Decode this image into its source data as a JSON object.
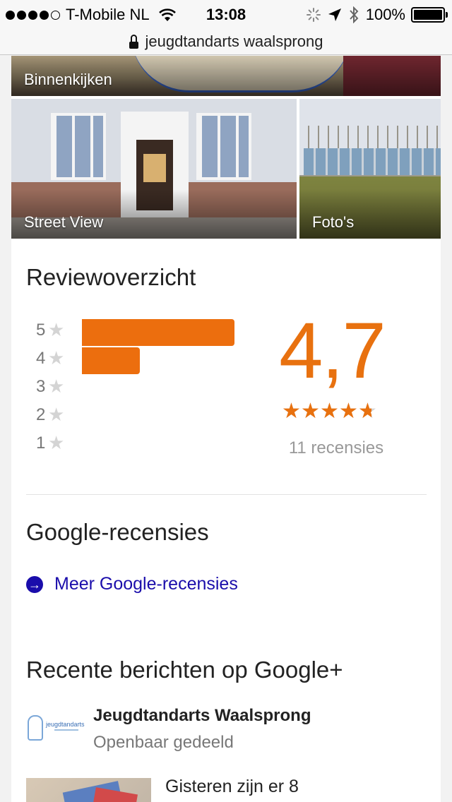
{
  "status_bar": {
    "carrier": "T-Mobile NL",
    "time": "13:08",
    "battery": "100%"
  },
  "url_bar": {
    "url": "jeugdtandarts waalsprong"
  },
  "photos": {
    "inside_label": "Binnenkijken",
    "street_view_label": "Street View",
    "photos_label": "Foto's"
  },
  "review_overview": {
    "title": "Reviewoverzicht",
    "histogram": [
      {
        "stars": "5",
        "fraction": 1.0
      },
      {
        "stars": "4",
        "fraction": 0.38
      },
      {
        "stars": "3",
        "fraction": 0
      },
      {
        "stars": "2",
        "fraction": 0
      },
      {
        "stars": "1",
        "fraction": 0
      }
    ],
    "rating": "4,7",
    "rating_value": 4.7,
    "review_count": "11 recensies"
  },
  "google_reviews": {
    "title": "Google-recensies",
    "more_link": "Meer Google-recensies"
  },
  "google_plus": {
    "title": "Recente berichten op Google+",
    "author": "Jeugdtandarts Waalsprong",
    "visibility": "Openbaar gedeeld",
    "snippet": "Gisteren zijn er 8"
  },
  "colors": {
    "accent": "#ec6e0e",
    "link": "#1a0dab"
  }
}
